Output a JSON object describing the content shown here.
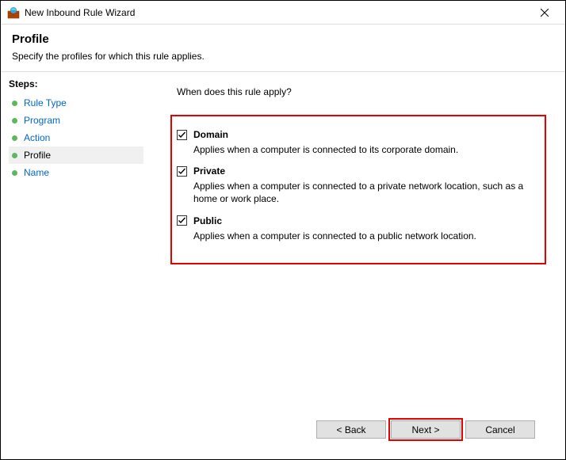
{
  "window": {
    "title": "New Inbound Rule Wizard"
  },
  "header": {
    "title": "Profile",
    "subtitle": "Specify the profiles for which this rule applies."
  },
  "sidebar": {
    "title": "Steps:",
    "items": [
      {
        "label": "Rule Type",
        "current": false
      },
      {
        "label": "Program",
        "current": false
      },
      {
        "label": "Action",
        "current": false
      },
      {
        "label": "Profile",
        "current": true
      },
      {
        "label": "Name",
        "current": false
      }
    ]
  },
  "content": {
    "prompt": "When does this rule apply?",
    "options": [
      {
        "label": "Domain",
        "checked": true,
        "desc": "Applies when a computer is connected to its corporate domain."
      },
      {
        "label": "Private",
        "checked": true,
        "desc": "Applies when a computer is connected to a private network location, such as a home or work place."
      },
      {
        "label": "Public",
        "checked": true,
        "desc": "Applies when a computer is connected to a public network location."
      }
    ]
  },
  "footer": {
    "back": "< Back",
    "next": "Next >",
    "cancel": "Cancel"
  }
}
